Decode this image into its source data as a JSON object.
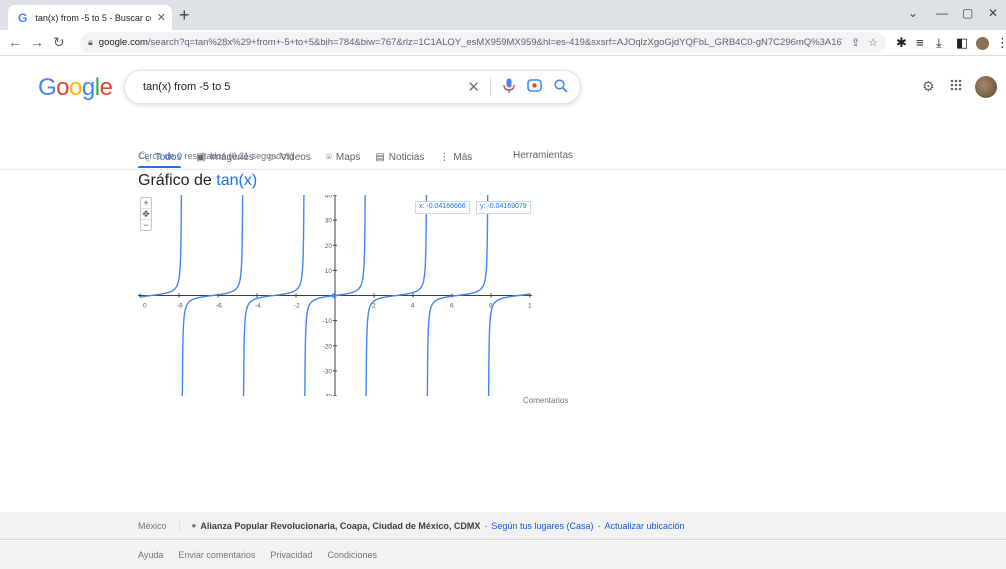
{
  "browser": {
    "tab_title": "tan(x) from -5 to 5 - Buscar con Google",
    "tab_favicon": "G",
    "address_host": "google.com",
    "address_rest": "/search?q=tan%28x%29+from+-5+to+5&bih=784&biw=767&rlz=1C1ALOY_esMX959MX959&hl=es-419&sxsrf=AJOqlzXgoGjdYQFbL_GRB4C0-gN7C296mQ%3A16776..."
  },
  "logo": {
    "g1": "G",
    "o1": "o",
    "o2": "o",
    "g2": "g",
    "l": "l",
    "e": "e"
  },
  "search": {
    "query": "tan(x) from -5 to 5"
  },
  "tabs": [
    {
      "label": "Todos",
      "icon": "search-icon"
    },
    {
      "label": "Imágenes",
      "icon": "image-icon"
    },
    {
      "label": "Videos",
      "icon": "video-icon"
    },
    {
      "label": "Maps",
      "icon": "map-pin-icon"
    },
    {
      "label": "Noticias",
      "icon": "news-icon"
    },
    {
      "label": "Más",
      "icon": "more-vert-icon"
    }
  ],
  "tools_label": "Herramientas",
  "result_stats": "Cerca de 0 resultados (0.21 segundos)",
  "graph": {
    "title_prefix": "Gráfico de",
    "title_fn": "tan(x)",
    "readout_x": "x: -0.04166666",
    "readout_y": "y: -0.04169079",
    "comentarios": "Comentarios"
  },
  "chart_data": {
    "type": "line",
    "title": "Gráfico de tan(x)",
    "function": "tan(x)",
    "xlim": [
      -10,
      1
    ],
    "ylim": [
      -40,
      40
    ],
    "x_ticks": [
      0,
      -8,
      -6,
      -4,
      -2,
      2,
      4,
      6,
      8,
      1
    ],
    "y_ticks": [
      40,
      30,
      20,
      10,
      -10,
      -20,
      -30,
      -40
    ],
    "grid": false,
    "series": [
      {
        "name": "tan(x)",
        "color": "#4285f4"
      }
    ]
  },
  "footer": {
    "country": "México",
    "place": "Alianza Popular Revolucionaria, Coapa, Ciudad de México, CDMX",
    "dash": "-",
    "loc_source": "Según tus lugares (Casa)",
    "update_loc": "Actualizar ubicación",
    "links": [
      "Ayuda",
      "Enviar comentarios",
      "Privacidad",
      "Condiciones"
    ]
  }
}
